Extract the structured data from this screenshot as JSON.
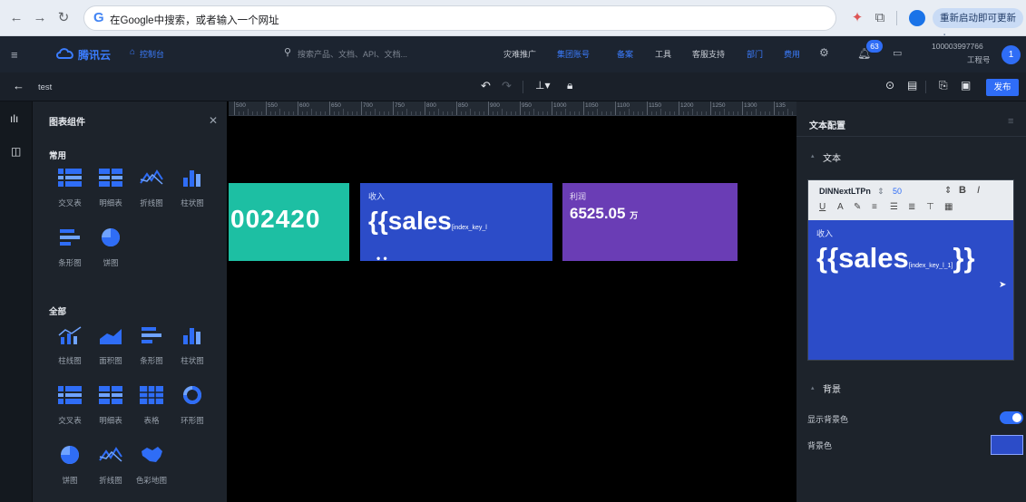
{
  "browser": {
    "omnibox_text": "在Google中搜索，或者输入一个网址",
    "restart_label": "重新启动即可更新"
  },
  "appbar": {
    "brand": "腾讯云",
    "console": "控制台",
    "search_placeholder": "搜索产品、文档、API、文档...",
    "links": [
      "灾难推广",
      "集团账号",
      "备案",
      "工具",
      "客服支持",
      "部门",
      "费用"
    ],
    "notification_count": "63",
    "account_id": "100003997766",
    "account_label": "工程号",
    "avatar_letter": "1"
  },
  "toolbar": {
    "back_title": "test",
    "publish_label": "发布"
  },
  "components": {
    "title": "图表组件",
    "common_title": "常用",
    "all_title": "全部",
    "common": [
      {
        "label": "交叉表",
        "icon": "cross-table-icon"
      },
      {
        "label": "明细表",
        "icon": "detail-table-icon"
      },
      {
        "label": "折线图",
        "icon": "line-chart-icon"
      },
      {
        "label": "柱状图",
        "icon": "bar-chart-icon"
      },
      {
        "label": "条形图",
        "icon": "hbar-chart-icon"
      },
      {
        "label": "饼图",
        "icon": "pie-chart-icon"
      }
    ],
    "all": [
      {
        "label": "柱线图",
        "icon": "bar-line-icon"
      },
      {
        "label": "面积图",
        "icon": "area-chart-icon"
      },
      {
        "label": "条形图",
        "icon": "hbar-chart-icon"
      },
      {
        "label": "柱状图",
        "icon": "bar-chart-icon"
      },
      {
        "label": "交叉表",
        "icon": "cross-table-icon"
      },
      {
        "label": "明细表",
        "icon": "detail-table-icon"
      },
      {
        "label": "表格",
        "icon": "table-icon"
      },
      {
        "label": "环形图",
        "icon": "ring-chart-icon"
      },
      {
        "label": "饼图",
        "icon": "pie-chart-icon"
      },
      {
        "label": "折线图",
        "icon": "line-chart-icon"
      },
      {
        "label": "色彩地图",
        "icon": "color-map-icon"
      }
    ]
  },
  "ruler": {
    "ticks": [
      "500",
      "550",
      "600",
      "650",
      "700",
      "750",
      "800",
      "850",
      "900",
      "950",
      "1000",
      "1050",
      "1100",
      "1150",
      "1200",
      "1250",
      "1300",
      "135"
    ]
  },
  "canvas": {
    "cards": [
      {
        "label": "",
        "value": "002420",
        "color": "#1dbfa3"
      },
      {
        "label": "收入",
        "value": "{{sales",
        "sub": "[index_key_l",
        "color": "#2c4cc8"
      },
      {
        "label": "利润",
        "value": "6525.05",
        "unit": "万",
        "color": "#6a3db5"
      }
    ]
  },
  "props": {
    "title": "文本配置",
    "text_section": "文本",
    "font_name": "DINNextLTPn",
    "font_size": "50",
    "preview_label": "收入",
    "preview_text": "{{sales",
    "preview_sub": "[index_key_l_1]",
    "preview_close": "}}",
    "bg_section": "背景",
    "show_bg_label": "显示背景色",
    "bg_color_label": "背景色",
    "bg_color": "#2c4cc8",
    "accent": "#2f6df6"
  }
}
